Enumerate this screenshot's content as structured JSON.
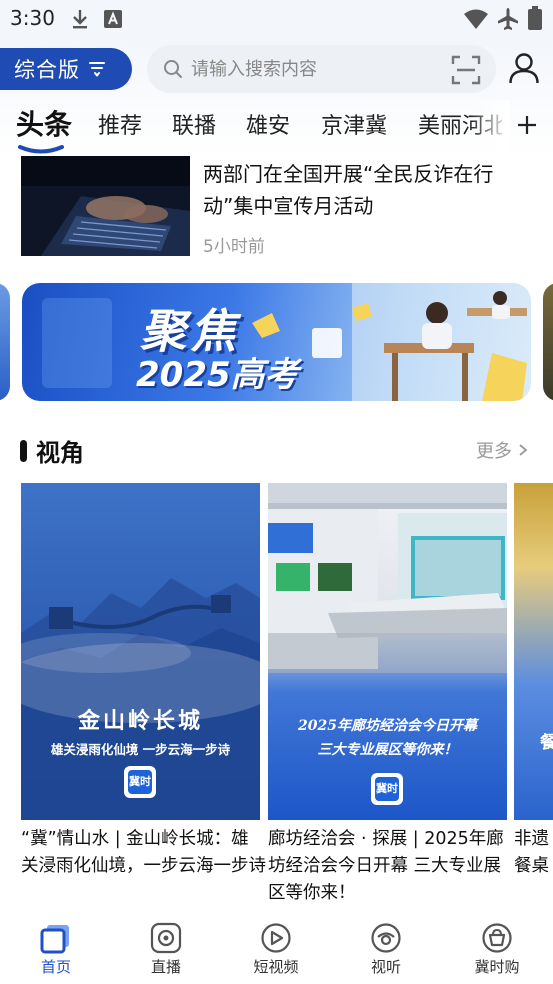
{
  "status_bar": {
    "time": "3:30"
  },
  "header": {
    "edition_label": "综合版",
    "search_placeholder": "请输入搜索内容"
  },
  "tabs": [
    {
      "label": "头条",
      "active": true
    },
    {
      "label": "推荐",
      "active": false
    },
    {
      "label": "联播",
      "active": false
    },
    {
      "label": "雄安",
      "active": false
    },
    {
      "label": "京津冀",
      "active": false
    },
    {
      "label": "美丽河北",
      "active": false
    }
  ],
  "news_item": {
    "title": "两部门在全国开展“全民反诈在行动”集中宣传月活动",
    "time": "5小时前"
  },
  "banner": {
    "line1": "聚焦",
    "line2": "2025高考"
  },
  "section": {
    "title": "视角",
    "more_label": "更多"
  },
  "cards": [
    {
      "image_title": "金山岭长城",
      "image_subtitle": "雄关浸雨化仙境 一步云海一步诗",
      "caption": "“冀”情山水 | 金山岭长城：雄关浸雨化仙境，一步云海一步诗"
    },
    {
      "image_title_line1": "2025年廊坊经洽会今日开幕",
      "image_title_line2": "三大专业展区等你来！",
      "caption": "廊坊经洽会 · 探展 | 2025年廊坊经洽会今日开幕 三大专业展区等你来！"
    },
    {
      "image_text": "餐",
      "caption_line1": "非遗",
      "caption_line2": "餐桌"
    }
  ],
  "app_badge_text": "冀时",
  "bottom_nav": [
    {
      "label": "首页",
      "active": true
    },
    {
      "label": "直播",
      "active": false
    },
    {
      "label": "短视频",
      "active": false
    },
    {
      "label": "视听",
      "active": false
    },
    {
      "label": "冀时购",
      "active": false
    }
  ],
  "colors": {
    "brand_blue": "#1f4bb5",
    "active_nav": "#1e50c8"
  }
}
